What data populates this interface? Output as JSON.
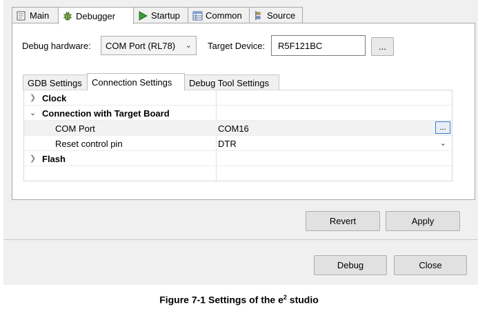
{
  "tabs": [
    {
      "label": "Main",
      "icon": "main-tab-icon"
    },
    {
      "label": "Debugger",
      "icon": "bug-icon"
    },
    {
      "label": "Startup",
      "icon": "play-icon"
    },
    {
      "label": "Common",
      "icon": "common-table-icon"
    },
    {
      "label": "Source",
      "icon": "source-lookup-icon"
    }
  ],
  "debugger": {
    "hardware_label": "Debug hardware:",
    "hardware_value": "COM Port (RL78)",
    "target_label": "Target Device:",
    "target_value": "R5F121BC",
    "browse_label": "..."
  },
  "inner_tabs": [
    {
      "label": "GDB Settings"
    },
    {
      "label": "Connection Settings"
    },
    {
      "label": "Debug Tool Settings"
    }
  ],
  "tree": {
    "rows": [
      {
        "key": "Clock",
        "value": ""
      },
      {
        "key": "Connection with Target Board",
        "value": ""
      },
      {
        "key": "COM Port",
        "value": "COM16"
      },
      {
        "key": "Reset control pin",
        "value": "DTR"
      },
      {
        "key": "Flash",
        "value": ""
      }
    ],
    "ellipsis": "..."
  },
  "buttons": {
    "revert": "Revert",
    "apply": "Apply",
    "debug": "Debug",
    "close": "Close"
  },
  "caption": {
    "prefix": "Figure 7-1   Settings of the e",
    "sup": "2",
    "suffix": " studio"
  },
  "colors": {
    "window_bg": "#f0f0f0",
    "panel_bg": "#ffffff",
    "border": "#a7a7a7",
    "accent": "#3c7fd0"
  }
}
